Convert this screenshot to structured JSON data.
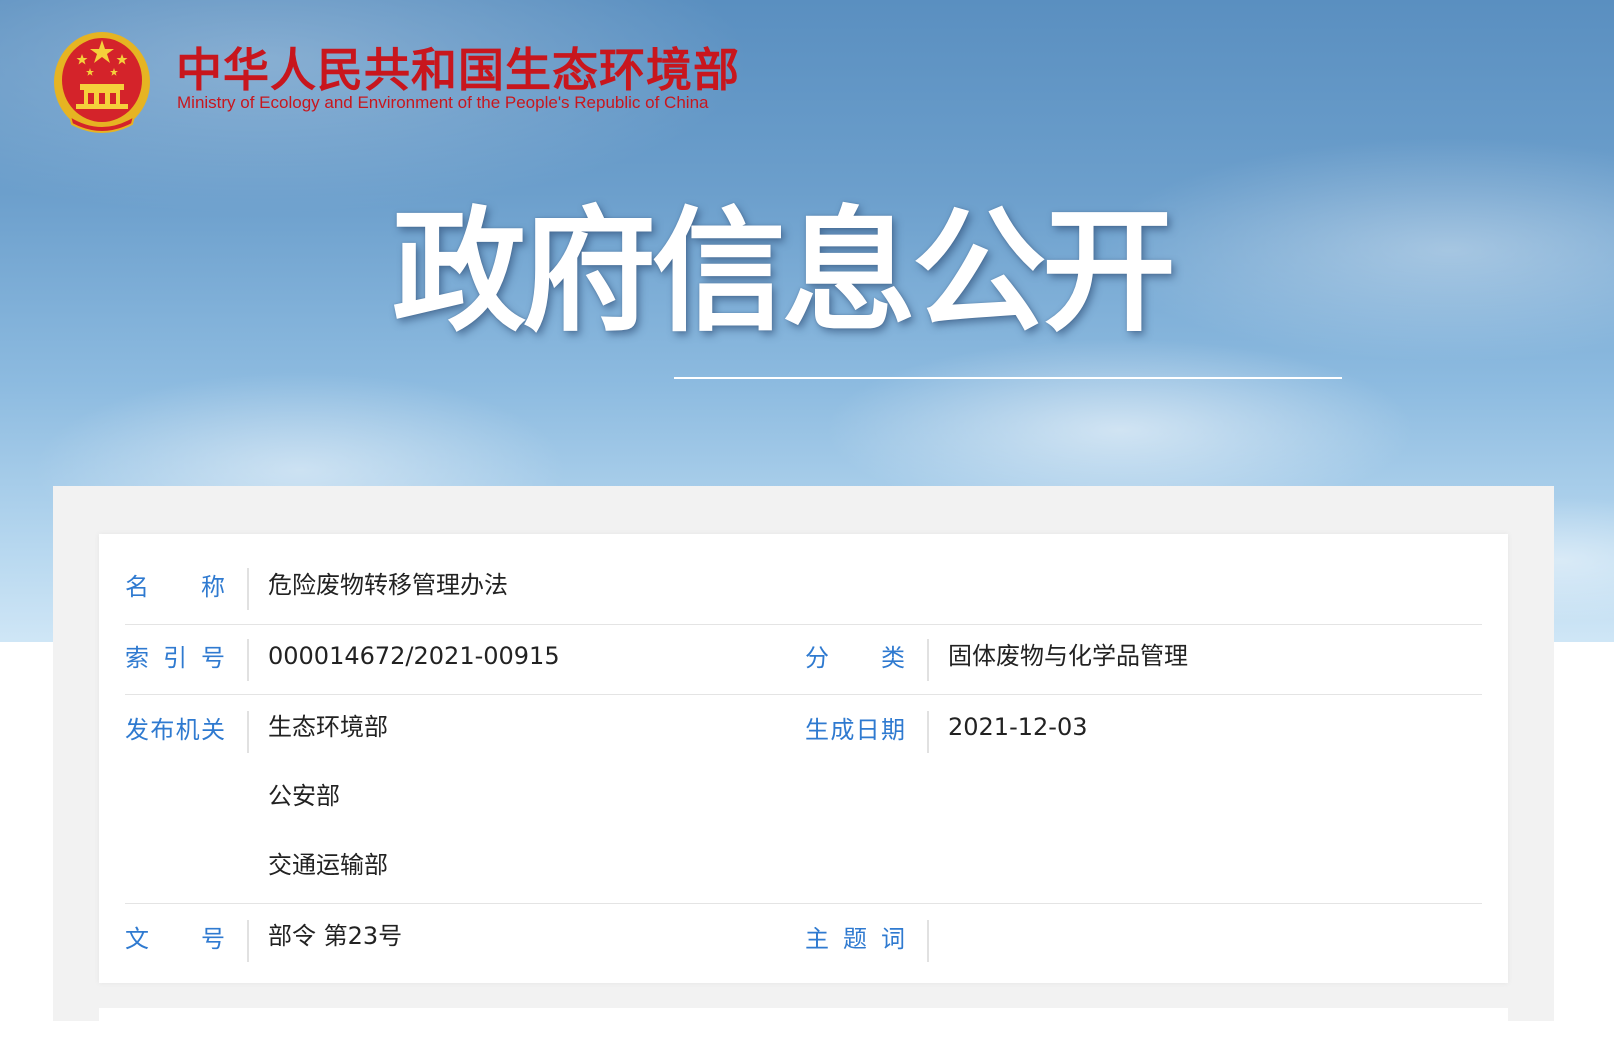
{
  "header": {
    "org_name_cn": "中华人民共和国生态环境部",
    "org_name_en": "Ministry of Ecology and Environment of the People's Republic of China",
    "banner_title": "政府信息公开"
  },
  "colors": {
    "brand_red": "#c8161d",
    "label_blue": "#2f7ad0",
    "text_dark": "#222222"
  },
  "metadata": {
    "name_label": "名称",
    "name_value": "危险废物转移管理办法",
    "index_label": "索引号",
    "index_value": "000014672/2021-00915",
    "category_label": "分类",
    "category_value": "固体废物与化学品管理",
    "issuer_label": "发布机关",
    "issuers": [
      "生态环境部",
      "公安部",
      "交通运输部"
    ],
    "date_label": "生成日期",
    "date_value": "2021-12-03",
    "docno_label": "文号",
    "docno_value": "部令 第23号",
    "keywords_label": "主题词",
    "keywords_value": ""
  }
}
